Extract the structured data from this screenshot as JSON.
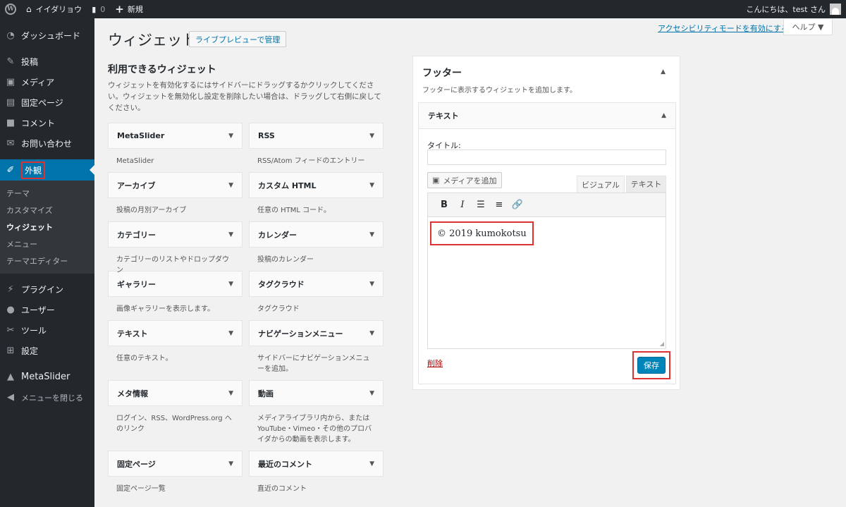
{
  "adminbar": {
    "site_name": "イイダリョウ",
    "comments_count": "0",
    "new_label": "新規",
    "greeting": "こんにちは、test さん"
  },
  "sidebar": {
    "items_top": [
      {
        "label": "ダッシュボード",
        "icon": "dashboard-icon"
      },
      {
        "label": "投稿",
        "icon": "pin-icon"
      },
      {
        "label": "メディア",
        "icon": "media-icon"
      },
      {
        "label": "固定ページ",
        "icon": "page-icon"
      },
      {
        "label": "コメント",
        "icon": "comment-icon"
      },
      {
        "label": "お問い合わせ",
        "icon": "mail-icon"
      }
    ],
    "appearance": "外観",
    "submenu": [
      "テーマ",
      "カスタマイズ",
      "ウィジェット",
      "メニュー",
      "テーマエディター"
    ],
    "items_bottom": [
      {
        "label": "プラグイン",
        "icon": "plugin-icon"
      },
      {
        "label": "ユーザー",
        "icon": "user-icon"
      },
      {
        "label": "ツール",
        "icon": "wrench-icon"
      },
      {
        "label": "設定",
        "icon": "settings-icon"
      }
    ],
    "metaslider": "MetaSlider",
    "collapse": "メニューを閉じる"
  },
  "header": {
    "title": "ウィジェット",
    "live_preview": "ライブプレビューで管理",
    "a11y": "アクセシビリティモードを有効にする",
    "help": "ヘルプ ▼"
  },
  "available": {
    "title": "利用できるウィジェット",
    "desc": "ウィジェットを有効化するにはサイドバーにドラッグするかクリックしてください。ウィジェットを無効化し設定を削除したい場合は、ドラッグして右側に戻してください。",
    "left": [
      {
        "name": "MetaSlider",
        "desc": "MetaSlider"
      },
      {
        "name": "アーカイブ",
        "desc": "投稿の月別アーカイブ"
      },
      {
        "name": "カテゴリー",
        "desc": "カテゴリーのリストやドロップダウン"
      },
      {
        "name": "ギャラリー",
        "desc": "画像ギャラリーを表示します。"
      },
      {
        "name": "テキスト",
        "desc": "任意のテキスト。"
      },
      {
        "name": "メタ情報",
        "desc": "ログイン、RSS、WordPress.org へのリンク"
      },
      {
        "name": "固定ページ",
        "desc": "固定ページ一覧"
      }
    ],
    "right": [
      {
        "name": "RSS",
        "desc": "RSS/Atom フィードのエントリー"
      },
      {
        "name": "カスタム HTML",
        "desc": "任意の HTML コード。"
      },
      {
        "name": "カレンダー",
        "desc": "投稿のカレンダー"
      },
      {
        "name": "タグクラウド",
        "desc": "タグクラウド"
      },
      {
        "name": "ナビゲーションメニュー",
        "desc": "サイドバーにナビゲーションメニューを追加。"
      },
      {
        "name": "動画",
        "desc": "メディアライブラリ内から、または YouTube・Vimeo・その他のプロバイダからの動画を表示します。"
      },
      {
        "name": "最近のコメント",
        "desc": "直近のコメント"
      }
    ]
  },
  "footer_area": {
    "title": "フッター",
    "desc": "フッターに表示するウィジェットを追加します。",
    "widget_title": "テキスト",
    "title_label": "タイトル:",
    "title_value": "",
    "add_media": "メディアを追加",
    "tab_visual": "ビジュアル",
    "tab_text": "テキスト",
    "content": "© 2019 kumokotsu",
    "delete": "削除",
    "save": "保存"
  },
  "colors": {
    "accent": "#0073aa",
    "highlight": "#dc3232",
    "save": "#0085ba"
  }
}
